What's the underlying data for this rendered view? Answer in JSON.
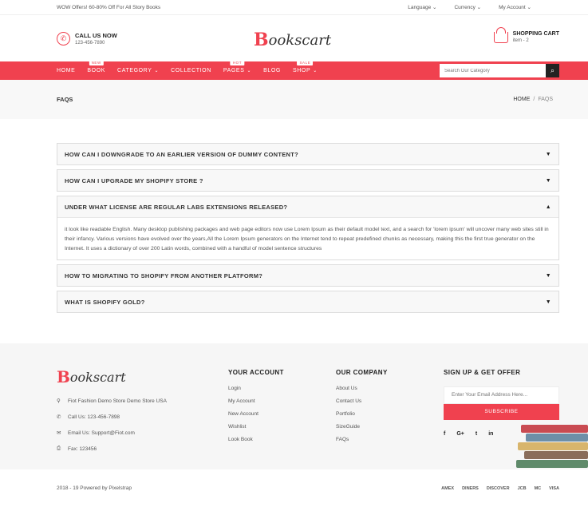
{
  "topbar": {
    "offer": "WOW Offers! 60-80% Off For All Story Books",
    "language": "Language",
    "currency": "Currency",
    "account": "My Account"
  },
  "header": {
    "call_title": "CALL US NOW",
    "call_number": "123-456-7890",
    "logo_first": "B",
    "logo_rest": "ookscart",
    "cart_title": "SHOPPING CART",
    "cart_items": "item - 2"
  },
  "nav": {
    "items": [
      {
        "label": "HOME",
        "badge": "",
        "chevron": false
      },
      {
        "label": "BOOK",
        "badge": "NEW",
        "chevron": false
      },
      {
        "label": "CATEGORY",
        "badge": "",
        "chevron": true
      },
      {
        "label": "COLLECTION",
        "badge": "",
        "chevron": false
      },
      {
        "label": "PAGES",
        "badge": "HOT",
        "chevron": true
      },
      {
        "label": "BLOG",
        "badge": "",
        "chevron": false
      },
      {
        "label": "SHOP",
        "badge": "SALE",
        "chevron": true
      }
    ],
    "search_placeholder": "Search Our Category",
    "search_icon": "search-icon"
  },
  "breadcrumb": {
    "title": "FAQS",
    "home": "HOME",
    "separator": "/",
    "current": "FAQS"
  },
  "faq": {
    "items": [
      {
        "question": "HOW CAN I DOWNGRADE TO AN EARLIER VERSION OF DUMMY CONTENT?",
        "open": false,
        "answer": ""
      },
      {
        "question": "HOW CAN I UPGRADE MY SHOPIFY STORE ?",
        "open": false,
        "answer": ""
      },
      {
        "question": "UNDER WHAT LICENSE ARE REGULAR LABS EXTENSIONS RELEASED?",
        "open": true,
        "answer": "it look like readable English. Many desktop publishing packages and web page editors now use Lorem Ipsum as their default model text, and a search for 'lorem ipsum' will uncover many web sites still in their infancy. Various versions have evolved over the years,All the Lorem Ipsum generators on the Internet tend to repeat predefined chunks as necessary, making this the first true generator on the Internet. It uses a dictionary of over 200 Latin words, combined with a handful of model sentence structures"
      },
      {
        "question": "HOW TO MIGRATING TO SHOPIFY FROM ANOTHER PLATFORM?",
        "open": false,
        "answer": ""
      },
      {
        "question": "WHAT IS SHOPIFY GOLD?",
        "open": false,
        "answer": ""
      }
    ]
  },
  "footer": {
    "logo_first": "B",
    "logo_rest": "ookscart",
    "address": "Fiot Fashion Demo Store Demo Store USA",
    "phone": "Call Us: 123-456-7898",
    "email": "Email Us: Support@Fiot.com",
    "fax": "Fax: 123456",
    "account_title": "YOUR ACCOUNT",
    "account_links": [
      "Login",
      "My Account",
      "New Account",
      "Wishlist",
      "Look Book"
    ],
    "company_title": "OUR COMPANY",
    "company_links": [
      "About Us",
      "Contact Us",
      "Portfolio",
      "SizeGuide",
      "FAQs"
    ],
    "signup_title": "SIGN UP & GET OFFER",
    "email_placeholder": "Enter Your Email Address Here...",
    "subscribe": "SUBSCRIBE",
    "social": [
      "f",
      "G+",
      "t",
      "in"
    ]
  },
  "bottombar": {
    "copyright": "2018 - 19 Powered by Pixelstrap",
    "payments": [
      "AMEX",
      "DINERS",
      "DISCOVER",
      "JCB",
      "MC",
      "VISA"
    ]
  },
  "colors": {
    "accent": "#f0414f"
  }
}
